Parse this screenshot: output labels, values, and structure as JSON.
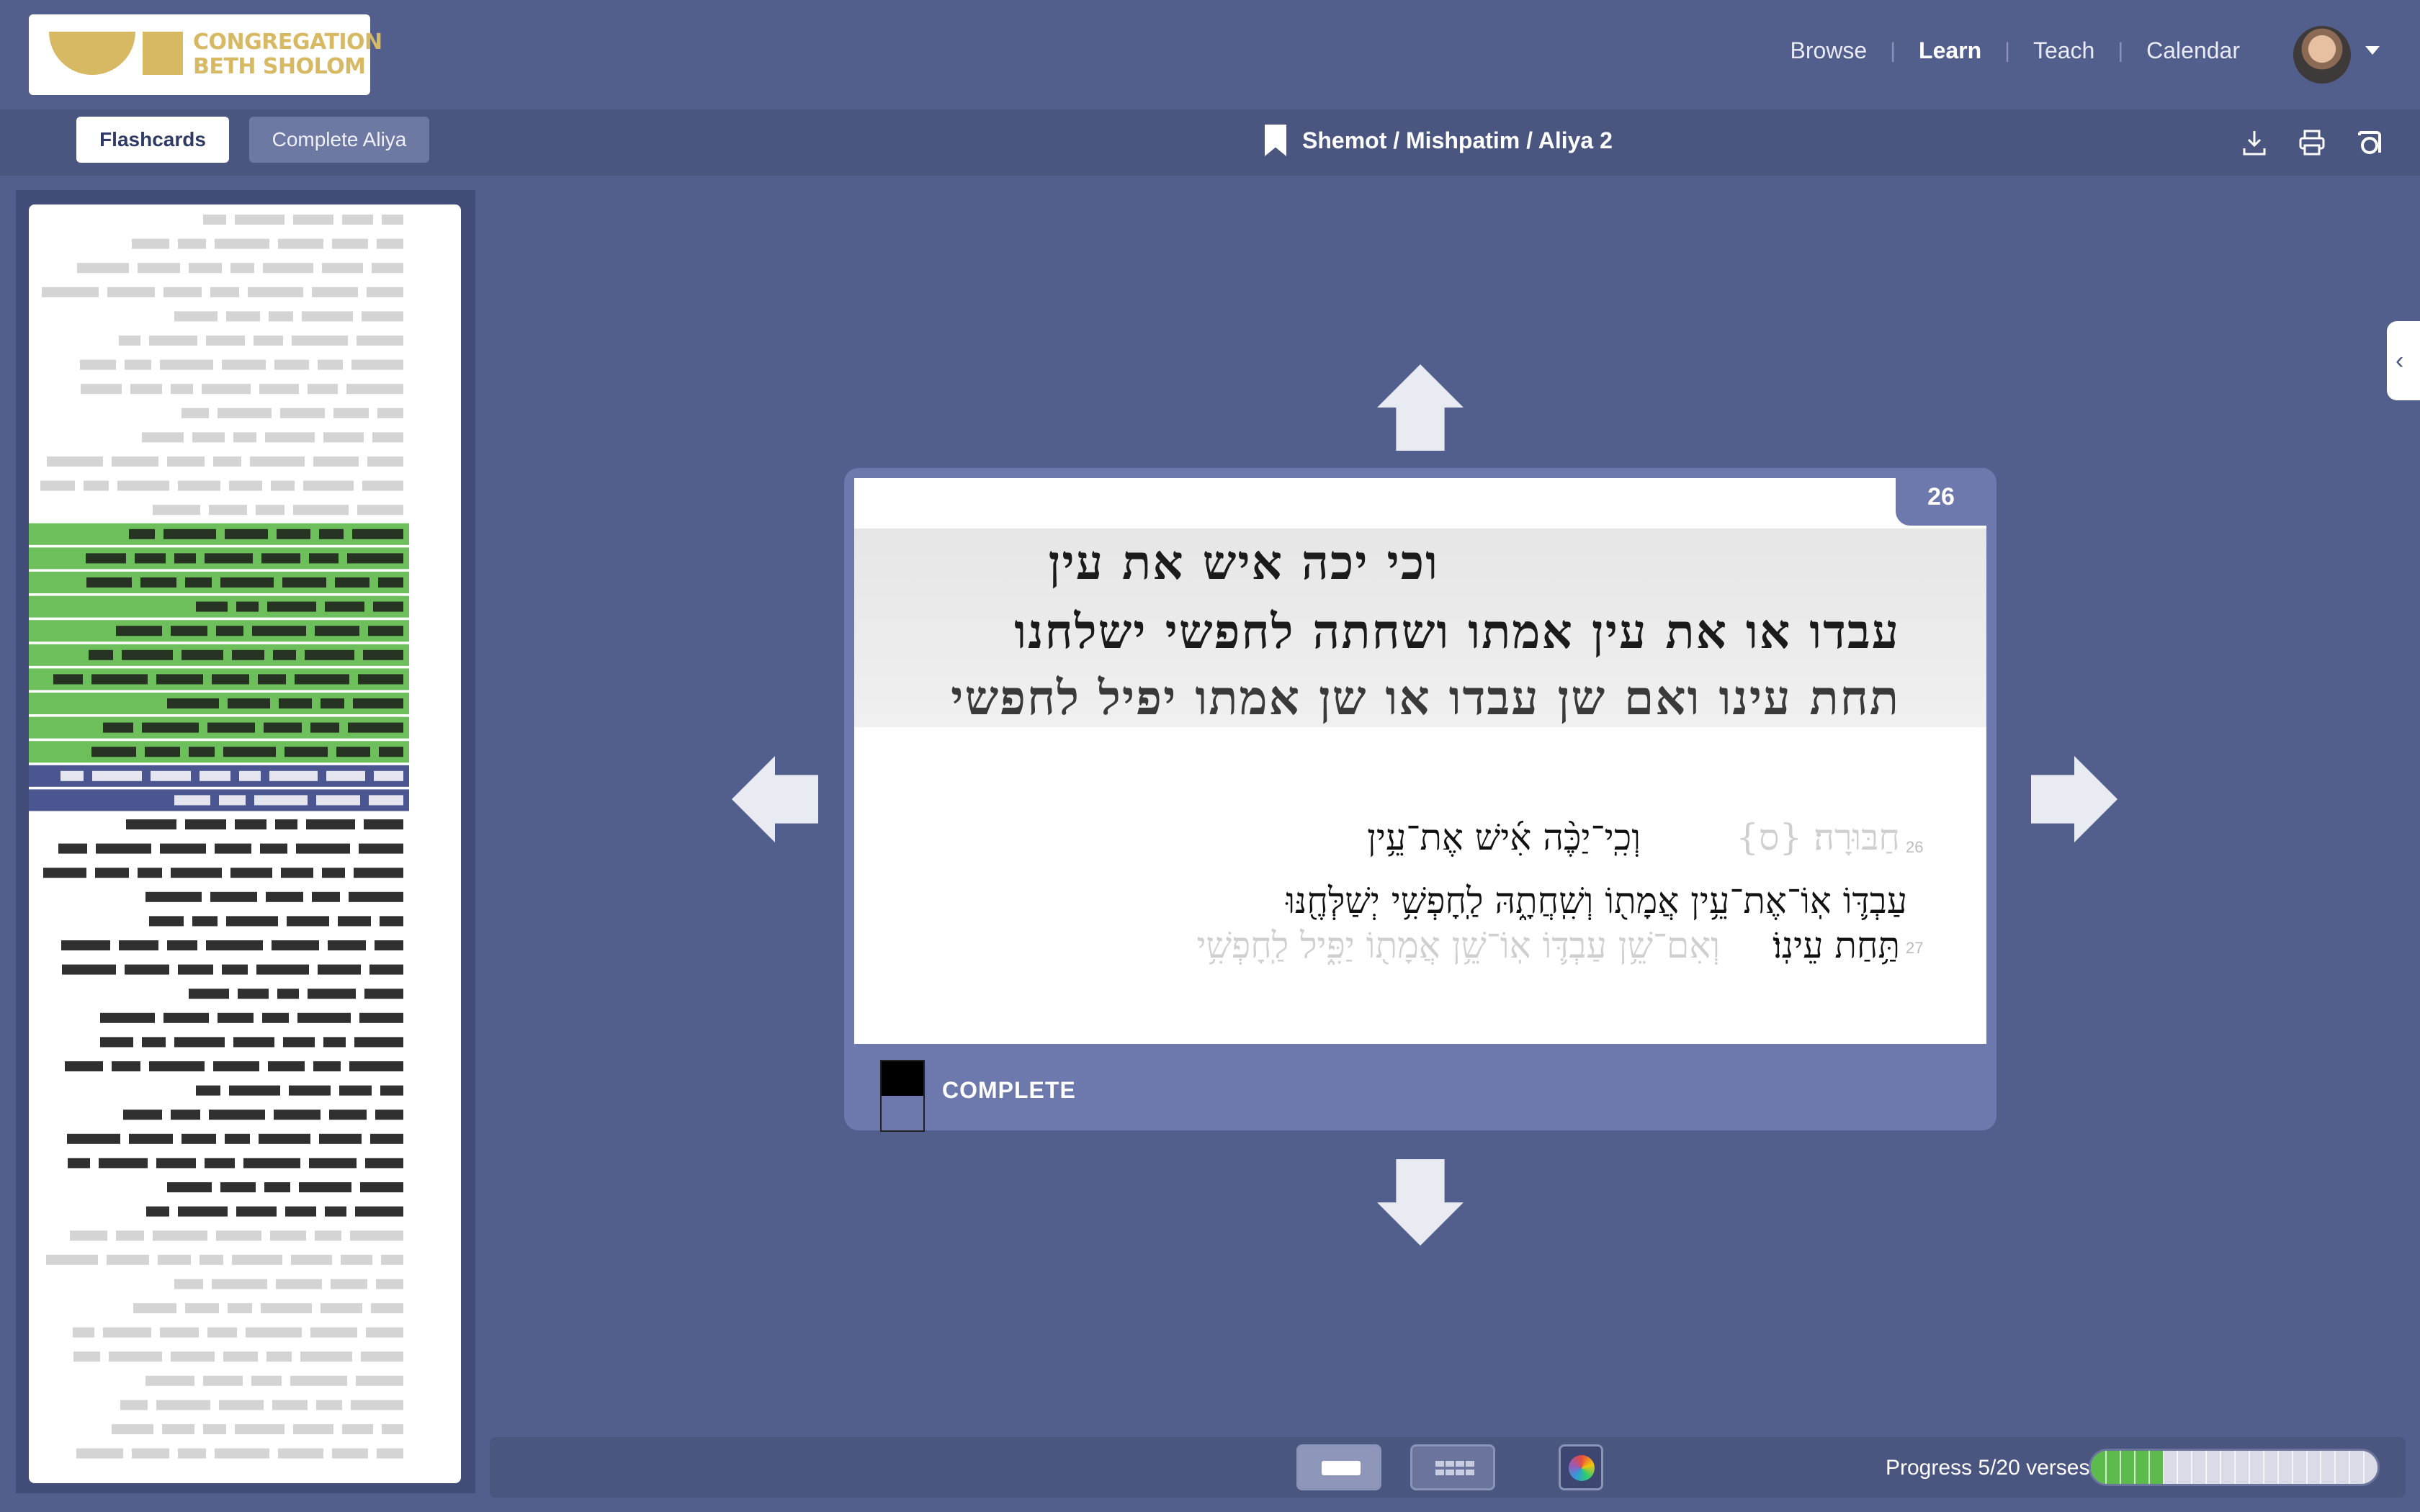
{
  "logo": {
    "line1": "CONGREGATION",
    "line2": "BETH SHOLOM",
    "color": "#d7b964"
  },
  "nav": {
    "items": [
      "Browse",
      "Learn",
      "Teach",
      "Calendar"
    ],
    "active": "Learn",
    "separator": "|"
  },
  "toolbar": {
    "flashcards_label": "Flashcards",
    "complete_aliya_label": "Complete Aliya",
    "breadcrumb": "Shemot / Mishpatim / Aliya 2",
    "icons": [
      "download-icon",
      "print-icon",
      "hebrew-font-icon"
    ]
  },
  "card": {
    "verse_number": "26",
    "scroll_lines": [
      "וכי יכה איש את עין",
      "עבדו או את עין אמתו ושחתה לחפשי ישלחנו",
      "תחת עינו ואם שן עבדו או שן אמתו יפיל לחפשי"
    ],
    "prev_fragment": "חַבּוּרָה׃ {ס}",
    "line1": "וְכִֽי־יַכֶּ֨ה אִ֜ישׁ אֶת־עֵ֥ין",
    "line2": "עַבְדּ֛וֹ אֽוֹ־אֶת־עֵ֥ין אֲמָת֖וֹ וְשִֽׁחֲתָ֑הּ לַֽחָפְשִׁ֥י יְשַׁלְּחֶ֖נּוּ",
    "line3_active": "תַּ֥חַת עֵינֽוֹ׃",
    "line3_faded": "וְאִם־שֵׁ֥ן עַבְדּ֛וֹ אֽוֹ־שֵׁ֥ן אֲמָת֖וֹ יַפִּ֑יל לַֽחָפְשִׁ֥י",
    "left_num_26": "26",
    "left_num_27": "27",
    "status_label": "COMPLETE"
  },
  "progress": {
    "label": "Progress 5/20 verses",
    "done": 5,
    "total": 20,
    "color": "#5dbb4d"
  },
  "colors": {
    "background": "#525e8c",
    "card": "#6d79ad",
    "highlight_green": "#6cbf5b",
    "highlight_blue": "#4b5590"
  }
}
